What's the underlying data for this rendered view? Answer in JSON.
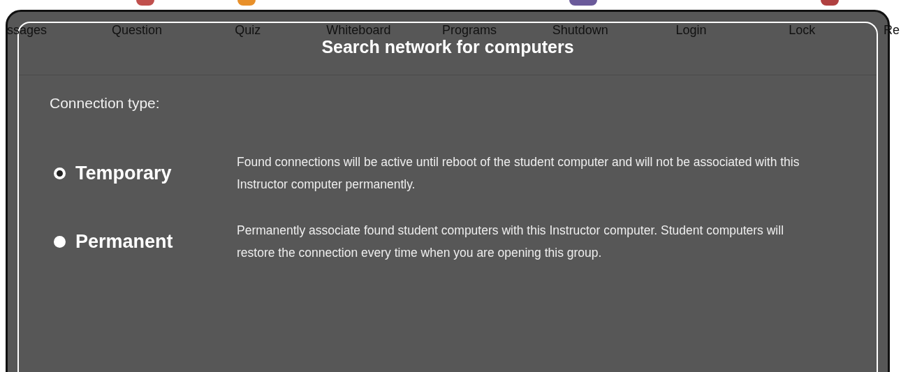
{
  "toolbar": {
    "items": [
      "ssages",
      "Question",
      "Quiz",
      "Whiteboard",
      "Programs",
      "Shutdown",
      "Login",
      "Lock",
      "Re"
    ]
  },
  "dialog": {
    "title": "Search network for computers",
    "section_label": "Connection type:",
    "options": [
      {
        "label": "Temporary",
        "description": "Found connections will be active until reboot of the student computer and will not be associated with this Instructor computer permanently.",
        "selected": true
      },
      {
        "label": "Permanent",
        "description": "Permanently associate found student computers with this Instructor computer. Student computers will restore the connection every time when you are opening this group.",
        "selected": false
      }
    ]
  }
}
